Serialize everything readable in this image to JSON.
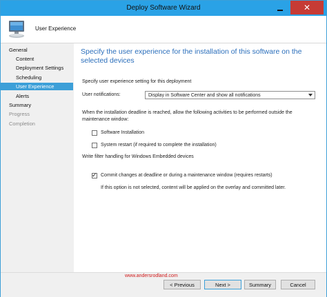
{
  "window": {
    "title": "Deploy Software Wizard",
    "close_glyph": "✕"
  },
  "header": {
    "page_label": "User Experience",
    "icon": "computer-icon"
  },
  "nav": {
    "items": [
      {
        "label": "General",
        "level": "top",
        "state": "normal"
      },
      {
        "label": "Content",
        "level": "sub",
        "state": "normal"
      },
      {
        "label": "Deployment Settings",
        "level": "sub",
        "state": "normal"
      },
      {
        "label": "Scheduling",
        "level": "sub",
        "state": "normal"
      },
      {
        "label": "User Experience",
        "level": "sub",
        "state": "selected"
      },
      {
        "label": "Alerts",
        "level": "sub",
        "state": "normal"
      },
      {
        "label": "Summary",
        "level": "top",
        "state": "normal"
      },
      {
        "label": "Progress",
        "level": "top",
        "state": "disabled"
      },
      {
        "label": "Completion",
        "level": "top",
        "state": "disabled"
      }
    ]
  },
  "main": {
    "heading": "Specify the user experience for the installation of this software on the selected devices",
    "intro": "Specify user experience setting for this deployment",
    "notifications_label": "User notifications:",
    "notifications_value": "Display in Software Center and show all notifications",
    "deadline_text": "When the installation deadline is reached, allow the following activities to be performed outside the maintenance window:",
    "software_installation": {
      "label": "Software Installation",
      "checked": false
    },
    "system_restart": {
      "label": "System restart  (if required to complete the installation)",
      "checked": false
    },
    "write_filter_label": "Write filter handling for Windows Embedded devices",
    "commit_changes": {
      "label": "Commit changes at deadline or during a maintenance window (requires restarts)",
      "checked": true
    },
    "commit_note": "If this option is not selected, content will be applied on the overlay and committed later.",
    "check_glyph": "✓"
  },
  "footer": {
    "watermark": "www.andersrodland.com",
    "previous_label": "< Previous",
    "next_label": "Next >",
    "summary_label": "Summary",
    "cancel_label": "Cancel"
  },
  "colors": {
    "accent": "#3c9fd8",
    "title_bar": "#2aa2e6",
    "heading": "#2a6ebb",
    "close": "#c63b35",
    "watermark": "#d01818"
  }
}
